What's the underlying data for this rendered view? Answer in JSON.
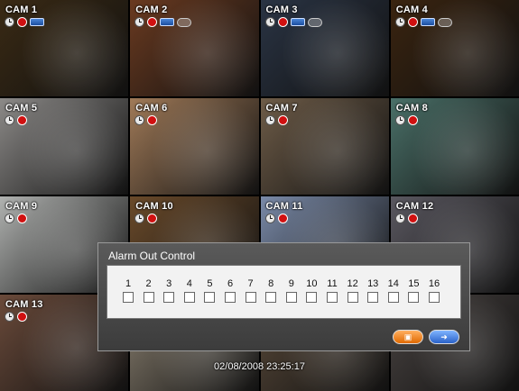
{
  "cameras": [
    {
      "label": "CAM 1",
      "icons": [
        "clock-icon",
        "record-icon",
        "network-icon"
      ],
      "bg": "#3a2a14"
    },
    {
      "label": "CAM 2",
      "icons": [
        "clock-icon",
        "record-icon",
        "network-icon",
        "ptz-icon"
      ],
      "bg": "#6a3a20"
    },
    {
      "label": "CAM 3",
      "icons": [
        "clock-icon",
        "record-icon",
        "network-icon",
        "ptz-icon"
      ],
      "bg": "#2a3444"
    },
    {
      "label": "CAM 4",
      "icons": [
        "clock-icon",
        "record-icon",
        "network-icon",
        "ptz-icon"
      ],
      "bg": "#3a2410"
    },
    {
      "label": "CAM 5",
      "icons": [
        "clock-icon",
        "record-icon"
      ],
      "bg": "#8c8a88"
    },
    {
      "label": "CAM 6",
      "icons": [
        "clock-icon",
        "record-icon"
      ],
      "bg": "#a07a58"
    },
    {
      "label": "CAM 7",
      "icons": [
        "clock-icon",
        "record-icon"
      ],
      "bg": "#6e5c48"
    },
    {
      "label": "CAM 8",
      "icons": [
        "clock-icon",
        "record-icon"
      ],
      "bg": "#4a7068"
    },
    {
      "label": "CAM 9",
      "icons": [
        "clock-icon",
        "record-icon"
      ],
      "bg": "#b0b2b0"
    },
    {
      "label": "CAM 10",
      "icons": [
        "clock-icon",
        "record-icon"
      ],
      "bg": "#6a4a2a"
    },
    {
      "label": "CAM 11",
      "icons": [
        "clock-icon",
        "record-icon"
      ],
      "bg": "#7a8aa8"
    },
    {
      "label": "CAM 12",
      "icons": [
        "clock-icon",
        "record-icon"
      ],
      "bg": "#5a5860"
    },
    {
      "label": "CAM 13",
      "icons": [
        "clock-icon",
        "record-icon"
      ],
      "bg": "#6a4a3a"
    },
    {
      "label": "",
      "icons": [],
      "bg": "#8a8070"
    },
    {
      "label": "",
      "icons": [],
      "bg": "#5a4a3a"
    },
    {
      "label": "",
      "icons": [],
      "bg": "#4a4442"
    }
  ],
  "dialog": {
    "title": "Alarm Out Control",
    "channels": [
      "1",
      "2",
      "3",
      "4",
      "5",
      "6",
      "7",
      "8",
      "9",
      "10",
      "11",
      "12",
      "13",
      "14",
      "15",
      "16"
    ],
    "save_icon": "save-icon",
    "exit_icon": "exit-icon"
  },
  "osd": {
    "datetime": "02/08/2008 23:25:17"
  },
  "colors": {
    "record": "#d01010",
    "save_button": "#e06a00",
    "exit_button": "#2a62c8"
  }
}
